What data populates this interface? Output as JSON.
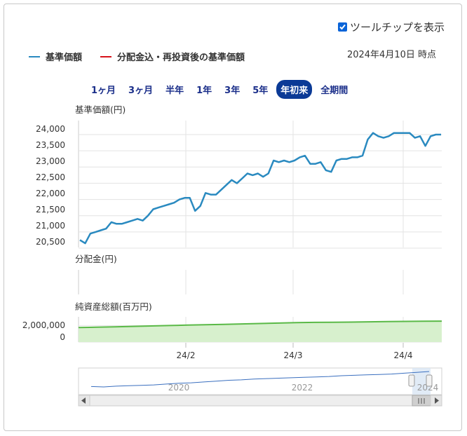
{
  "tooltip_toggle": {
    "label": "ツールチップを表示",
    "checked": true
  },
  "legend": {
    "items": [
      {
        "label": "基準価額",
        "color": "#2a8ac0"
      },
      {
        "label": "分配金込・再投資後の基準価額",
        "color": "#d7121b"
      }
    ]
  },
  "as_of": "2024年4月10日 時点",
  "periods": {
    "items": [
      "1ヶ月",
      "3ヶ月",
      "半年",
      "1年",
      "3年",
      "5年",
      "年初来",
      "全期間"
    ],
    "active_index": 6
  },
  "colors": {
    "nav_line": "#2a8ac0",
    "aum_line": "#5ab947",
    "aum_fill": "#d7f0cd",
    "navigator": "#3a6fbf"
  },
  "chart_data": [
    {
      "type": "line",
      "ylabel": "基準価額(円)",
      "y_ticks": [
        "24,000",
        "23,500",
        "23,000",
        "22,500",
        "22,000",
        "21,500",
        "21,000",
        "20,500"
      ],
      "ylim": [
        20500,
        24000
      ],
      "x_ticks": [
        "24/2",
        "24/3",
        "24/4"
      ],
      "series": [
        {
          "values": [
            20750,
            20650,
            20950,
            21000,
            21050,
            21100,
            21300,
            21250,
            21250,
            21300,
            21350,
            21400,
            21350,
            21500,
            21700,
            21750,
            21800,
            21850,
            21900,
            22000,
            22050,
            22050,
            21650,
            21800,
            22200,
            22150,
            22150,
            22300,
            22450,
            22600,
            22500,
            22650,
            22800,
            22750,
            22800,
            22700,
            22800,
            23200,
            23150,
            23200,
            23150,
            23200,
            23300,
            23350,
            23100,
            23100,
            23150,
            22900,
            22850,
            23200,
            23250,
            23250,
            23300,
            23300,
            23350,
            23850,
            24050,
            23950,
            23900,
            23950,
            24050,
            24050,
            24050,
            24050,
            23900,
            23950,
            23650,
            23950,
            24000,
            24000
          ]
        }
      ]
    },
    {
      "type": "bar",
      "ylabel": "分配金(円)",
      "values": []
    },
    {
      "type": "area",
      "ylabel": "純資産総額(百万円)",
      "y_ticks": [
        "2,000,000",
        "0"
      ],
      "ylim": [
        0,
        2800000
      ],
      "series": [
        {
          "values": [
            1760000,
            1800000,
            1850000,
            1900000,
            1950000,
            2000000,
            2050000,
            2100000,
            2150000,
            2200000,
            2250000,
            2300000,
            2350000,
            2380000,
            2400000,
            2420000,
            2450000,
            2480000,
            2500000,
            2520000,
            2540000
          ]
        }
      ]
    },
    {
      "type": "line",
      "x_ticks": [
        "2020",
        "2022",
        "2024"
      ],
      "series": [
        {
          "values": [
            18,
            17,
            19,
            20,
            21,
            22,
            24,
            26,
            27,
            29,
            31,
            33,
            34,
            36,
            37,
            38,
            39,
            40,
            41,
            42,
            44,
            45,
            46,
            47,
            48,
            50,
            52,
            54
          ]
        }
      ]
    }
  ]
}
